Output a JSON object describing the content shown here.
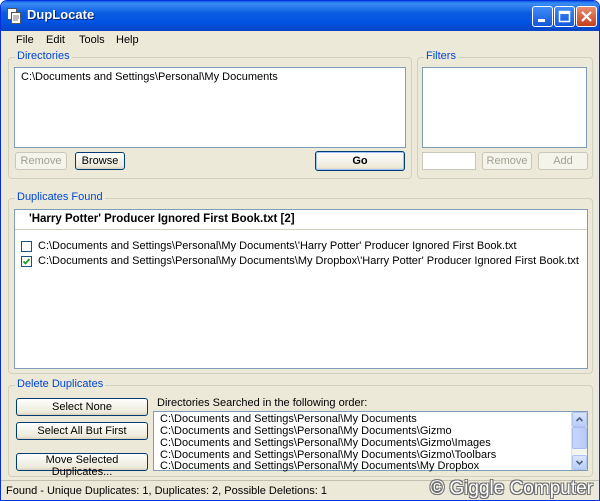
{
  "window": {
    "title": "DupLocate"
  },
  "menu": [
    "File",
    "Edit",
    "Tools",
    "Help"
  ],
  "directories": {
    "label": "Directories",
    "items": [
      "C:\\Documents and Settings\\Personal\\My Documents"
    ],
    "remove_label": "Remove",
    "browse_label": "Browse",
    "go_label": "Go"
  },
  "filters": {
    "label": "Filters",
    "input_value": "",
    "remove_label": "Remove",
    "add_label": "Add"
  },
  "duplicates": {
    "label": "Duplicates Found",
    "group_title": "'Harry Potter' Producer Ignored First Book.txt   [2]",
    "rows": [
      {
        "path": "C:\\Documents and Settings\\Personal\\My Documents\\'Harry Potter' Producer Ignored First Book.txt",
        "checked": false
      },
      {
        "path": "C:\\Documents and Settings\\Personal\\My Documents\\My Dropbox\\'Harry Potter' Producer Ignored First Book.txt",
        "checked": true
      }
    ]
  },
  "delete": {
    "label": "Delete Duplicates",
    "select_none_label": "Select None",
    "select_all_but_first_label": "Select All But First",
    "move_selected_label": "Move Selected Duplicates...",
    "order_label": "Directories Searched in the following order:",
    "order_items": [
      "C:\\Documents and Settings\\Personal\\My Documents",
      "C:\\Documents and Settings\\Personal\\My Documents\\Gizmo",
      "C:\\Documents and Settings\\Personal\\My Documents\\Gizmo\\Images",
      "C:\\Documents and Settings\\Personal\\My Documents\\Gizmo\\Toolbars",
      "C:\\Documents and Settings\\Personal\\My Documents\\My Dropbox"
    ]
  },
  "status": {
    "text": "Found - Unique Duplicates: 1, Duplicates: 2, Possible Deletions: 1",
    "watermark": "© Giggle Computer"
  },
  "colors": {
    "titlebar": "#0054e3",
    "group_label": "#0046d5",
    "checkmark": "#21a121",
    "window_bg": "#ece9d8"
  },
  "icons": [
    "app-icon",
    "minimize-icon",
    "maximize-icon",
    "close-icon",
    "checkmark-icon",
    "scroll-up-icon",
    "scroll-down-icon"
  ]
}
